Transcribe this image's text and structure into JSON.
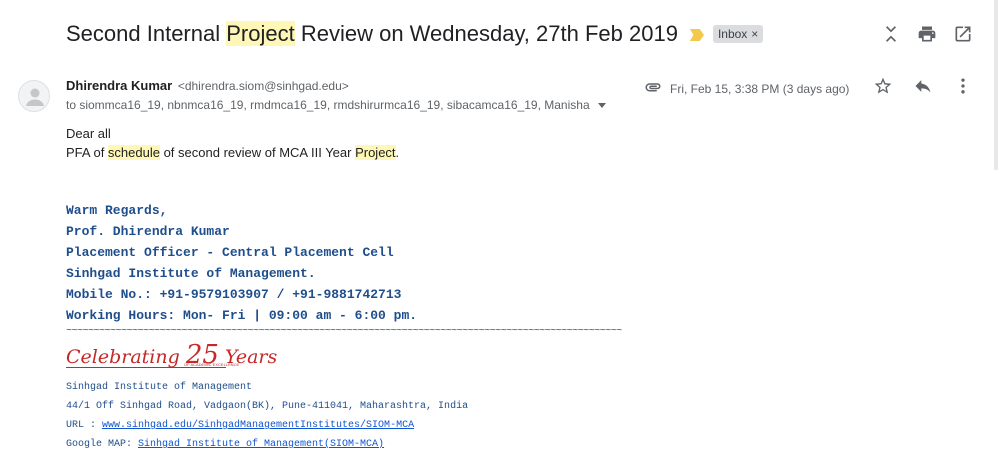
{
  "subject": {
    "before": "Second Internal ",
    "highlight": "Project",
    "after": " Review on Wednesday, 27th Feb 2019",
    "label": "Inbox",
    "label_remove": "×"
  },
  "sender": {
    "name": "Dhirendra Kumar",
    "email": "<dhirendra.siom@sinhgad.edu>",
    "to": "to siommca16_19, nbnmca16_19, rmdmca16_19, rmdshirurmca16_19, sibacamca16_19, Manisha",
    "date": "Fri, Feb 15, 3:38 PM (3 days ago)"
  },
  "body": {
    "greeting": "Dear all",
    "p1": "PFA of ",
    "hl1": "schedule",
    "p2": " of second review of MCA III Year ",
    "hl2": "Project",
    "p3": "."
  },
  "signature": {
    "line1": "Warm Regards,",
    "line2": "Prof. Dhirendra Kumar",
    "line3": "Placement Officer - Central Placement Cell",
    "line4": "Sinhgad Institute of Management.",
    "line5": "Mobile No.: +91-9579103907 / +91-9881742713",
    "line6": "Working Hours: Mon- Fri | 09:00 am - 6:00 pm.",
    "tilde": "~~~~~~~~~~~~~~~~~~~~~~~~~~~~~~~~~~~~~~~~~~~~~~~~~~~~~~~~~~~~~~~~~~~~~~~~~~~~~~~~~~~~~~~~~~~~~~~~~~~~~",
    "celebrate_a": "Celebrating ",
    "celebrate_num": "25",
    "celebrate_b": " Years",
    "celebrate_sub": "OF ACADEMIC EXCELLENCE",
    "institute": "Sinhgad Institute of Management",
    "address": "44/1 Off Sinhgad Road, Vadgaon(BK), Pune-411041, Maharashtra, India",
    "url_label": "URL : ",
    "url": "www.sinhgad.edu/SinhgadManagementInstitutes/SIOM-MCA",
    "map_label": "Google MAP: ",
    "map": "Sinhgad Institute of Management(SIOM-MCA)"
  },
  "icons": {
    "collapse": "collapse-icon",
    "print": "print-icon",
    "open_new": "open-in-new-window-icon",
    "attachment": "paperclip-icon",
    "star": "star-icon",
    "reply": "reply-icon",
    "more": "more-vertical-icon"
  },
  "colors": {
    "highlight": "#fef7b6",
    "signature": "#1f4e8c",
    "link": "#1155cc",
    "brand_red": "#c62828",
    "importance": "#f4c84a"
  }
}
